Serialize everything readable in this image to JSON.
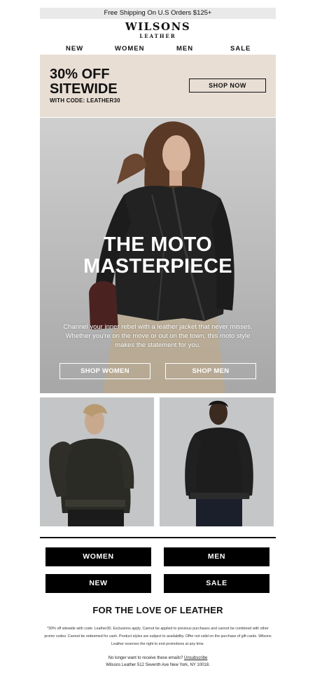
{
  "promo_bar": {
    "text": "Free Shipping On U.S Orders $125+"
  },
  "logo": {
    "line1": "WILSONS",
    "line2": "LEATHER"
  },
  "nav": {
    "items": [
      "NEW",
      "WOMEN",
      "MEN",
      "SALE"
    ]
  },
  "sale_banner": {
    "line1": "30% OFF",
    "line2": "SITEWIDE",
    "code": "WITH CODE: LEATHER30",
    "button": "SHOP NOW",
    "bg_color": "#e8ded4"
  },
  "hero": {
    "title_line1": "THE MOTO",
    "title_line2": "MASTERPIECE",
    "copy": "Channel your inner rebel with a leather jacket that never misses. Whether you're on the move or out on the town, this moto style makes the statement for you.",
    "button_women": "SHOP WOMEN",
    "button_men": "SHOP MEN"
  },
  "categories": {
    "women": "WOMEN",
    "men": "MEN",
    "new": "NEW",
    "sale": "SALE"
  },
  "footer": {
    "tagline": "FOR THE LOVE OF LEATHER",
    "legal": "*30% off sitewide with code: Leather30. Exclusions apply. Cannot be applied to previous purchases and cannot be combined with other promo codes. Cannot be redeemed for cash. Product styles are subject to availability. Offer not valid on the purchase of gift cards. Wilsons Leather reserves the right to end promotions at any time.",
    "unsub_prefix": "No longer want to receive these emails?",
    "unsub_link": "Unsubscribe",
    "address": "Wilsons Leather 512 Seventh Ave New York, NY 10018."
  }
}
